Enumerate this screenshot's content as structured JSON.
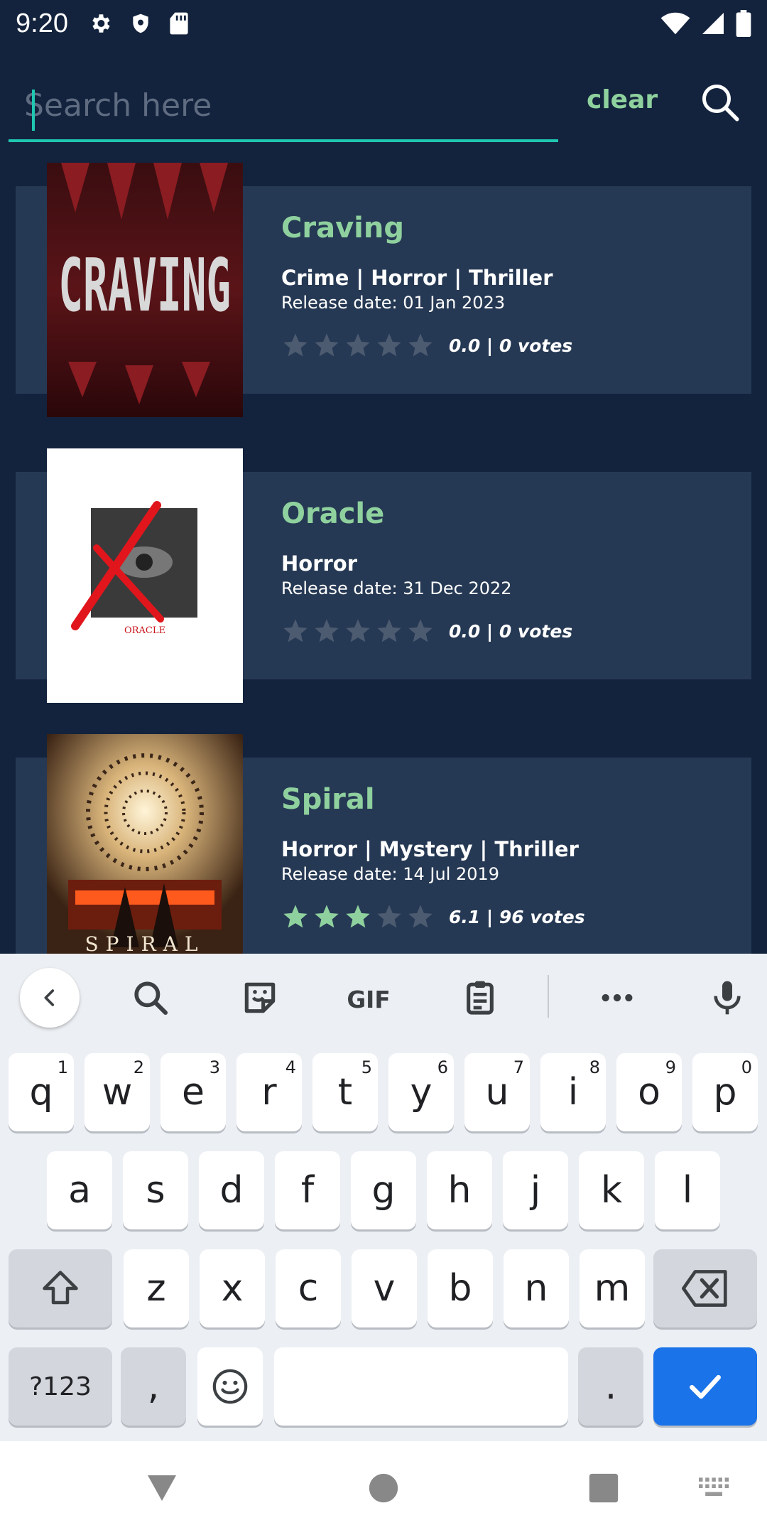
{
  "status_bar": {
    "time": "9:20",
    "left_icons": [
      "gear-icon",
      "shield-icon",
      "sd-card-icon"
    ],
    "right_icons": [
      "wifi-icon",
      "signal-icon",
      "battery-icon"
    ]
  },
  "search": {
    "placeholder": "Search here",
    "value": "",
    "clear_label": "clear",
    "accent_color": "#1fc7b1"
  },
  "movies": [
    {
      "title": "Craving",
      "genres": "Crime | Horror | Thriller",
      "release": "Release date: 01 Jan 2023",
      "rating": 0.0,
      "rating_text": "0.0 | 0 votes",
      "filled_stars": 0,
      "poster_text": "CRAVING"
    },
    {
      "title": "Oracle",
      "genres": "Horror",
      "release": "Release date: 31 Dec 2022",
      "rating": 0.0,
      "rating_text": "0.0 | 0 votes",
      "filled_stars": 0,
      "poster_text": "ORACLE"
    },
    {
      "title": "Spiral",
      "genres": "Horror | Mystery | Thriller",
      "release": "Release date: 14 Jul 2019",
      "rating": 6.1,
      "rating_text": "6.1 | 96 votes",
      "filled_stars": 3,
      "poster_text": "SPIRAL"
    }
  ],
  "keyboard": {
    "toolbar": [
      "back-icon",
      "search-icon",
      "sticker-icon",
      "GIF",
      "clipboard-icon",
      "more-icon",
      "mic-icon"
    ],
    "row1": [
      {
        "key": "q",
        "hint": "1"
      },
      {
        "key": "w",
        "hint": "2"
      },
      {
        "key": "e",
        "hint": "3"
      },
      {
        "key": "r",
        "hint": "4"
      },
      {
        "key": "t",
        "hint": "5"
      },
      {
        "key": "y",
        "hint": "6"
      },
      {
        "key": "u",
        "hint": "7"
      },
      {
        "key": "i",
        "hint": "8"
      },
      {
        "key": "o",
        "hint": "9"
      },
      {
        "key": "p",
        "hint": "0"
      }
    ],
    "row2": [
      "a",
      "s",
      "d",
      "f",
      "g",
      "h",
      "j",
      "k",
      "l"
    ],
    "row3": [
      "z",
      "x",
      "c",
      "v",
      "b",
      "n",
      "m"
    ],
    "symbols_label": "?123",
    "comma_label": ",",
    "period_label": "."
  },
  "colors": {
    "background": "#13233d",
    "card": "#263954",
    "title_green": "#8fd19e",
    "star_filled": "#8fd19e",
    "star_empty": "#4d5b71"
  }
}
